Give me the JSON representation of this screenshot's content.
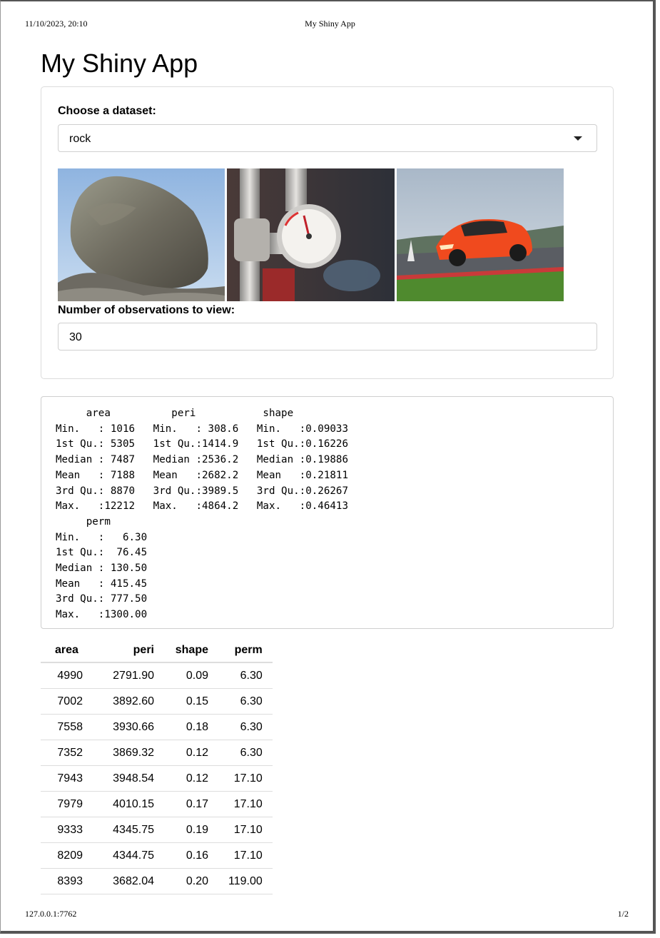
{
  "print_header": {
    "datetime": "11/10/2023, 20:10",
    "title": "My Shiny App"
  },
  "print_footer": {
    "url": "127.0.0.1:7762",
    "page": "1/2"
  },
  "app": {
    "title": "My Shiny App"
  },
  "sidebar": {
    "dataset_label": "Choose a dataset:",
    "dataset_selected": "rock",
    "images": [
      {
        "name": "rock-image"
      },
      {
        "name": "pressure-gauge-image"
      },
      {
        "name": "orange-car-image"
      }
    ],
    "obs_label": "Number of observations to view:",
    "obs_value": "30"
  },
  "summary_text": "     area          peri           shape        \nMin.   : 1016   Min.   : 308.6   Min.   :0.09033  \n1st Qu.: 5305   1st Qu.:1414.9   1st Qu.:0.16226  \nMedian : 7487   Median :2536.2   Median :0.19886  \nMean   : 7188   Mean   :2682.2   Mean   :0.21811  \n3rd Qu.: 8870   3rd Qu.:3989.5   3rd Qu.:0.26267  \nMax.   :12212   Max.   :4864.2   Max.   :0.46413  \n     perm        \nMin.   :   6.30  \n1st Qu.:  76.45  \nMedian : 130.50  \nMean   : 415.45  \n3rd Qu.: 777.50  \nMax.   :1300.00  ",
  "table": {
    "headers": [
      "area",
      "peri",
      "shape",
      "perm"
    ],
    "rows": [
      [
        "4990",
        "2791.90",
        "0.09",
        "6.30"
      ],
      [
        "7002",
        "3892.60",
        "0.15",
        "6.30"
      ],
      [
        "7558",
        "3930.66",
        "0.18",
        "6.30"
      ],
      [
        "7352",
        "3869.32",
        "0.12",
        "6.30"
      ],
      [
        "7943",
        "3948.54",
        "0.12",
        "17.10"
      ],
      [
        "7979",
        "4010.15",
        "0.17",
        "17.10"
      ],
      [
        "9333",
        "4345.75",
        "0.19",
        "17.10"
      ],
      [
        "8209",
        "4344.75",
        "0.16",
        "17.10"
      ],
      [
        "8393",
        "3682.04",
        "0.20",
        "119.00"
      ]
    ]
  }
}
